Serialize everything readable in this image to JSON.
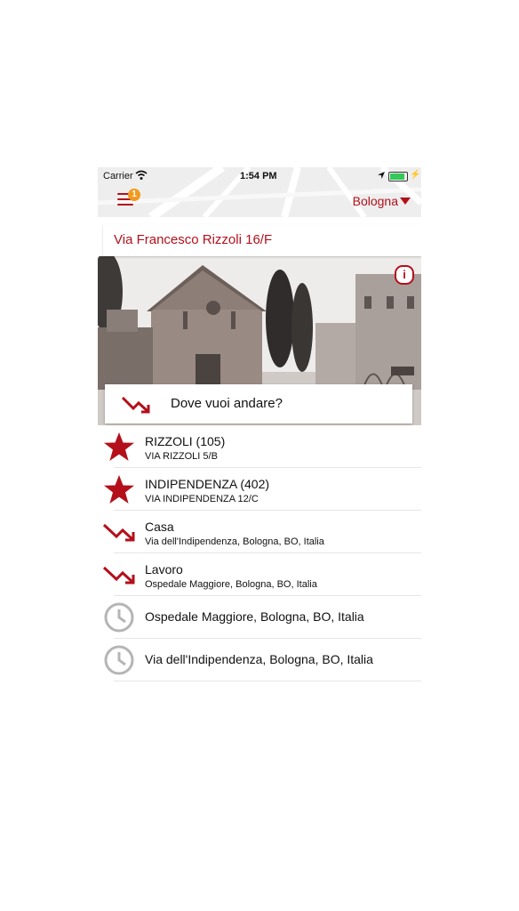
{
  "status": {
    "carrier": "Carrier",
    "time": "1:54 PM",
    "wifi_icon": "wifi-icon",
    "battery_icon": "battery-icon",
    "location_icon": "location-arrow-icon"
  },
  "header": {
    "badge_count": "1",
    "city": "Bologna"
  },
  "address": "Via Francesco Rizzoli 16/F",
  "search": {
    "placeholder": "Dove vuoi andare?"
  },
  "list": [
    {
      "type": "star",
      "title": "RIZZOLI (105)",
      "sub": "VIA RIZZOLI 5/B"
    },
    {
      "type": "star",
      "title": "INDIPENDENZA (402)",
      "sub": "VIA INDIPENDENZA 12/C"
    },
    {
      "type": "route",
      "title": "Casa",
      "sub": "Via dell'Indipendenza, Bologna, BO, Italia"
    },
    {
      "type": "route",
      "title": "Lavoro",
      "sub": "Ospedale Maggiore, Bologna, BO, Italia"
    },
    {
      "type": "history",
      "title": "Ospedale Maggiore, Bologna, BO, Italia"
    },
    {
      "type": "history",
      "title": "Via dell'Indipendenza, Bologna, BO, Italia"
    }
  ],
  "colors": {
    "accent": "#b3101b",
    "badge": "#f39a1e"
  }
}
